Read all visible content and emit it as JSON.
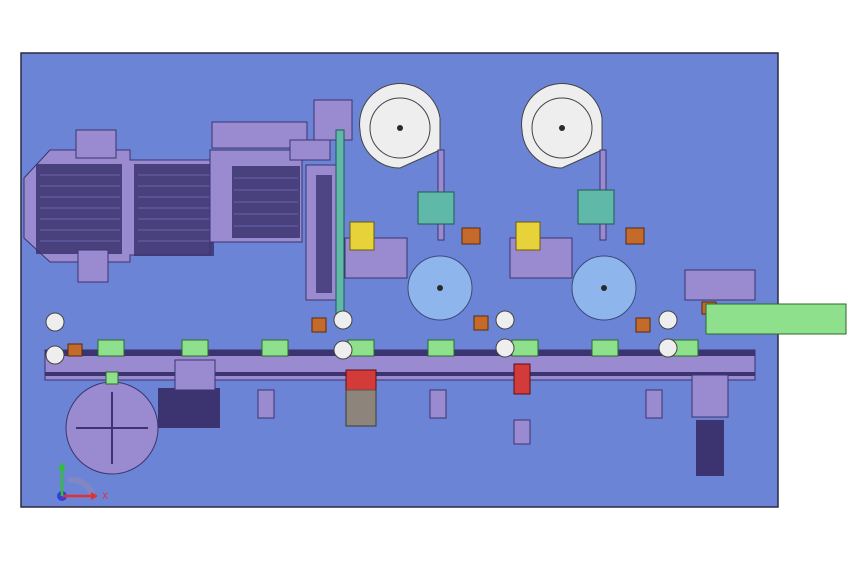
{
  "colors": {
    "canvas_background": "#ffffff",
    "sheet_fill": "#6b84d6",
    "sheet_border": "#2a2a40",
    "machine_purple": "#9a8ad0",
    "machine_dark": "#3b3470",
    "reel_white": "#eeeeee",
    "turntable_blue": "#8fb6ec",
    "pad_green": "#8ee08c",
    "teal_block": "#5fb8a8",
    "orange_part": "#c46a2a",
    "red_part": "#d33a3a",
    "axis_x": "#e53030",
    "axis_y": "#2fbf3a",
    "axis_z": "#3040e0"
  },
  "triad": {
    "x_label": "X",
    "icons": [
      "x-axis-arrow-icon",
      "y-axis-arrow-icon",
      "z-axis-origin-icon"
    ]
  },
  "components": [
    "vibration-feeder-tray",
    "linear-module",
    "tape-reel-left",
    "tape-reel-right",
    "rotary-turntable-left",
    "rotary-turntable-right",
    "rotary-index-table",
    "main-conveyor-rail",
    "output-chute",
    "servo-motor"
  ]
}
